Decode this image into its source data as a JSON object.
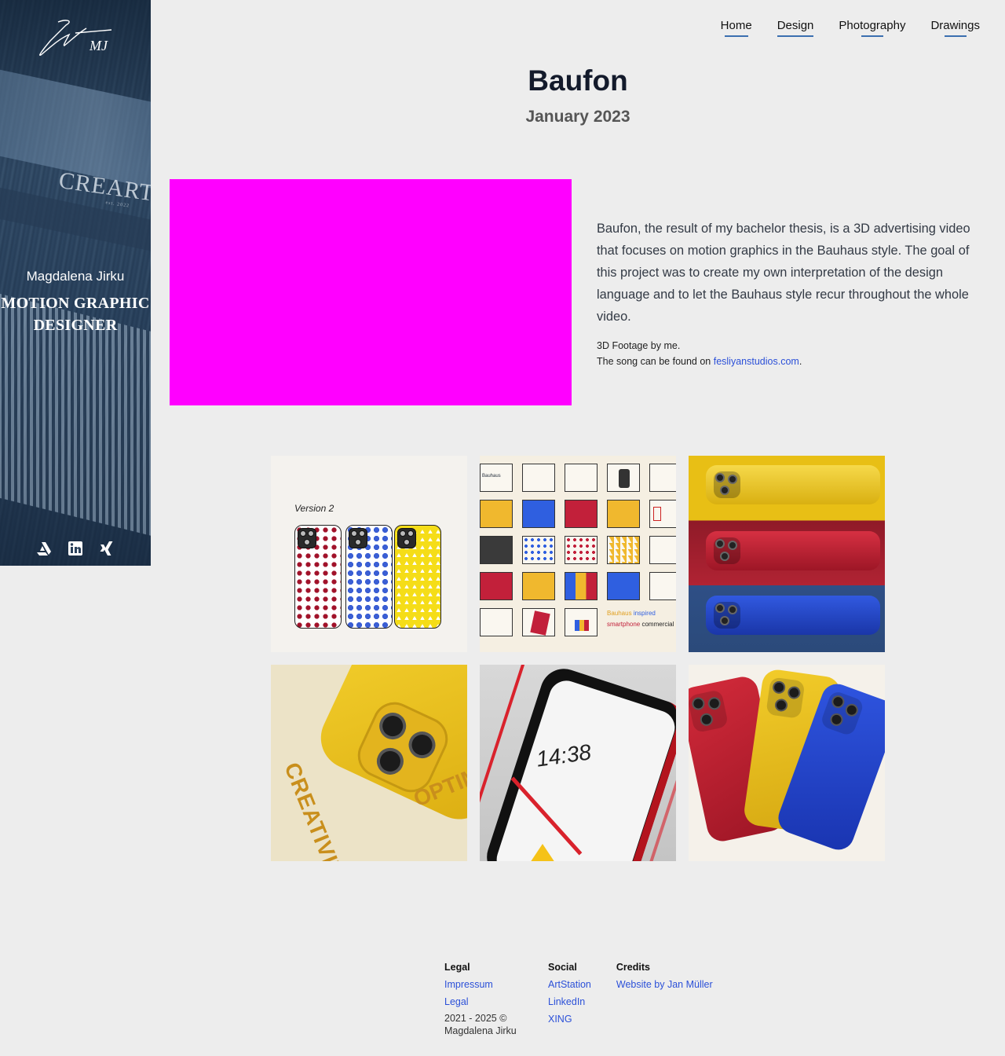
{
  "sidebar": {
    "name": "Magdalena Jirku",
    "role": "MOTION GRAPHIC DESIGNER",
    "logo_text": "MJ",
    "background_sign": "CREARTI",
    "background_sign_small": "est. 2022",
    "social": [
      {
        "icon": "artstation-icon"
      },
      {
        "icon": "linkedin-icon"
      },
      {
        "icon": "xing-icon"
      }
    ]
  },
  "nav": {
    "items": [
      {
        "label": "Home"
      },
      {
        "label": "Design"
      },
      {
        "label": "Photography"
      },
      {
        "label": "Drawings"
      }
    ],
    "accent": "#3b6fb0"
  },
  "project": {
    "title": "Baufon",
    "date": "January 2023",
    "description": "Baufon, the result of my bachelor thesis, is a 3D advertising video that focuses on motion graphics in the Bauhaus style. The goal of this project was to create my own interpretation of the design language and to let the Bauhaus style recur throughout the whole video.",
    "footage_credit": "3D Footage by me.",
    "song_prefix": "The song can be found on ",
    "song_link": "fesliyanstudios.com",
    "song_suffix": ".",
    "video_placeholder_color": "#ff00ff"
  },
  "gallery": {
    "tile1": {
      "label": "Version 2"
    },
    "tile2": {
      "label_bauhaus": "Bauhaus",
      "label_inspired": "inspired",
      "label_smartphone": "smartphone",
      "label_commercial": "commercial"
    },
    "tile4": {
      "word1": "CREATIVITY",
      "word2": "OPTIM"
    },
    "tile5": {
      "time": "14:38"
    }
  },
  "footer": {
    "legal": {
      "heading": "Legal",
      "links": [
        "Impressum",
        "Legal"
      ],
      "copyright": "2021 - 2025 © Magdalena Jirku"
    },
    "social": {
      "heading": "Social",
      "links": [
        "ArtStation",
        "LinkedIn",
        "XING"
      ]
    },
    "credits": {
      "heading": "Credits",
      "links": [
        "Website by Jan Müller"
      ]
    }
  },
  "colors": {
    "page_bg": "#ededed",
    "link": "#2b50d8",
    "bauhaus_red": "#b02333",
    "bauhaus_yellow": "#e8bf15",
    "bauhaus_blue": "#2f5fe0"
  }
}
